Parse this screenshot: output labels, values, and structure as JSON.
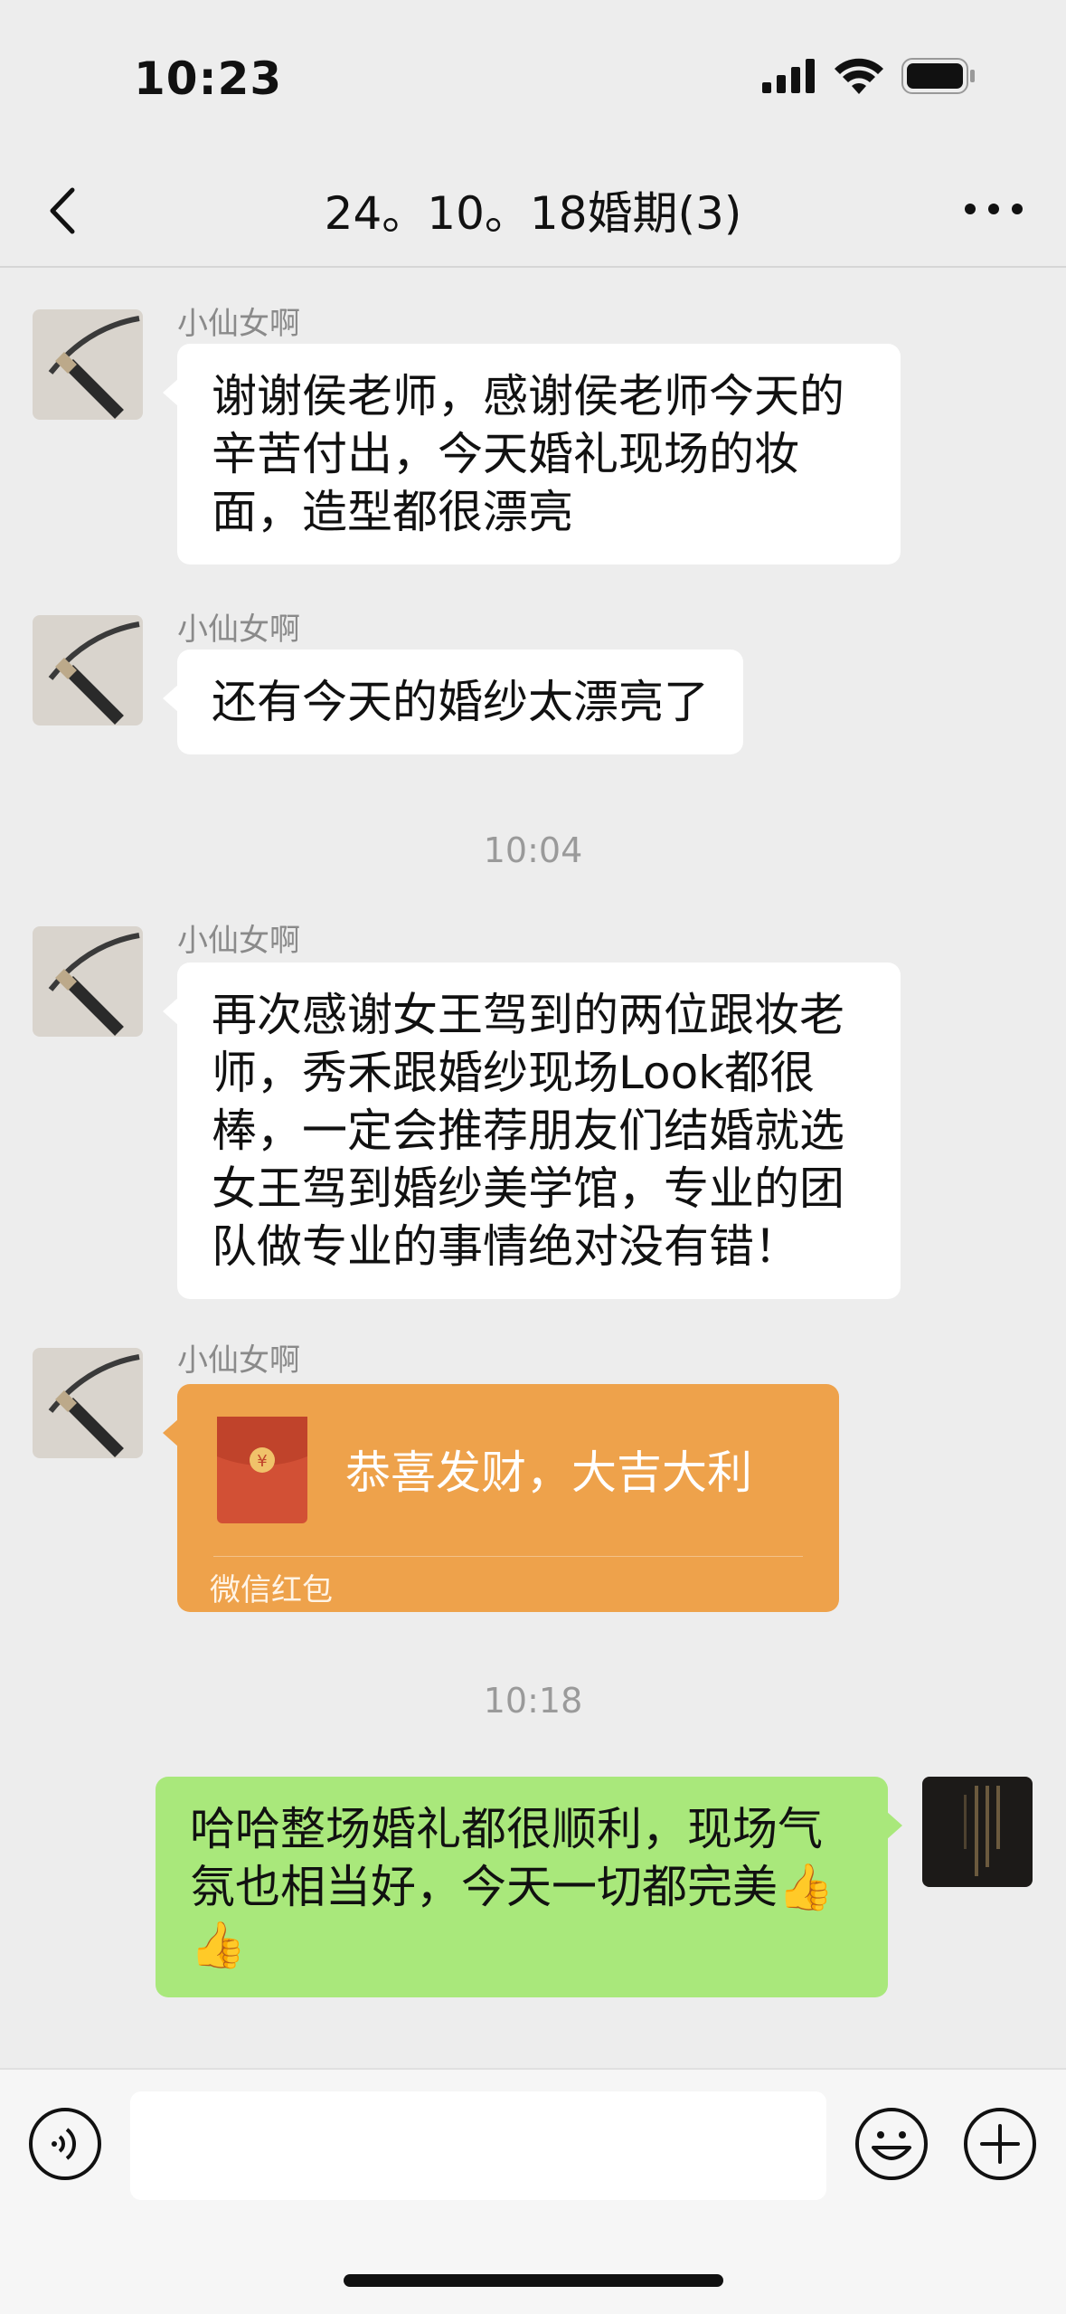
{
  "status": {
    "time": "10:23"
  },
  "nav": {
    "title": "24。10。18婚期(3)"
  },
  "messages": [
    {
      "sender": "小仙女啊",
      "text": "谢谢侯老师，感谢侯老师今天的辛苦付出，今天婚礼现场的妆面，造型都很漂亮"
    },
    {
      "sender": "小仙女啊",
      "text": "还有今天的婚纱太漂亮了"
    },
    {
      "timestamp": "10:04"
    },
    {
      "sender": "小仙女啊",
      "text": "再次感谢女王驾到的两位跟妆老师，秀禾跟婚纱现场Look都很棒，一定会推荐朋友们结婚就选女王驾到婚纱美学馆，专业的团队做专业的事情绝对没有错！"
    },
    {
      "sender": "小仙女啊",
      "redpacket": {
        "title": "恭喜发财，大吉大利",
        "label": "微信红包"
      }
    },
    {
      "timestamp": "10:18"
    },
    {
      "self": true,
      "text": "哈哈整场婚礼都很顺利，现场气氛也相当好，今天一切都完美👍👍"
    }
  ],
  "colors": {
    "background": "#ededed",
    "self_bubble": "#a9e87b",
    "redpacket": "#eea24b"
  },
  "icons": [
    "back-arrow-icon",
    "more-dots-icon",
    "signal-icon",
    "wifi-icon",
    "battery-icon",
    "voice-icon",
    "emoji-icon",
    "plus-icon",
    "yuan-icon"
  ]
}
